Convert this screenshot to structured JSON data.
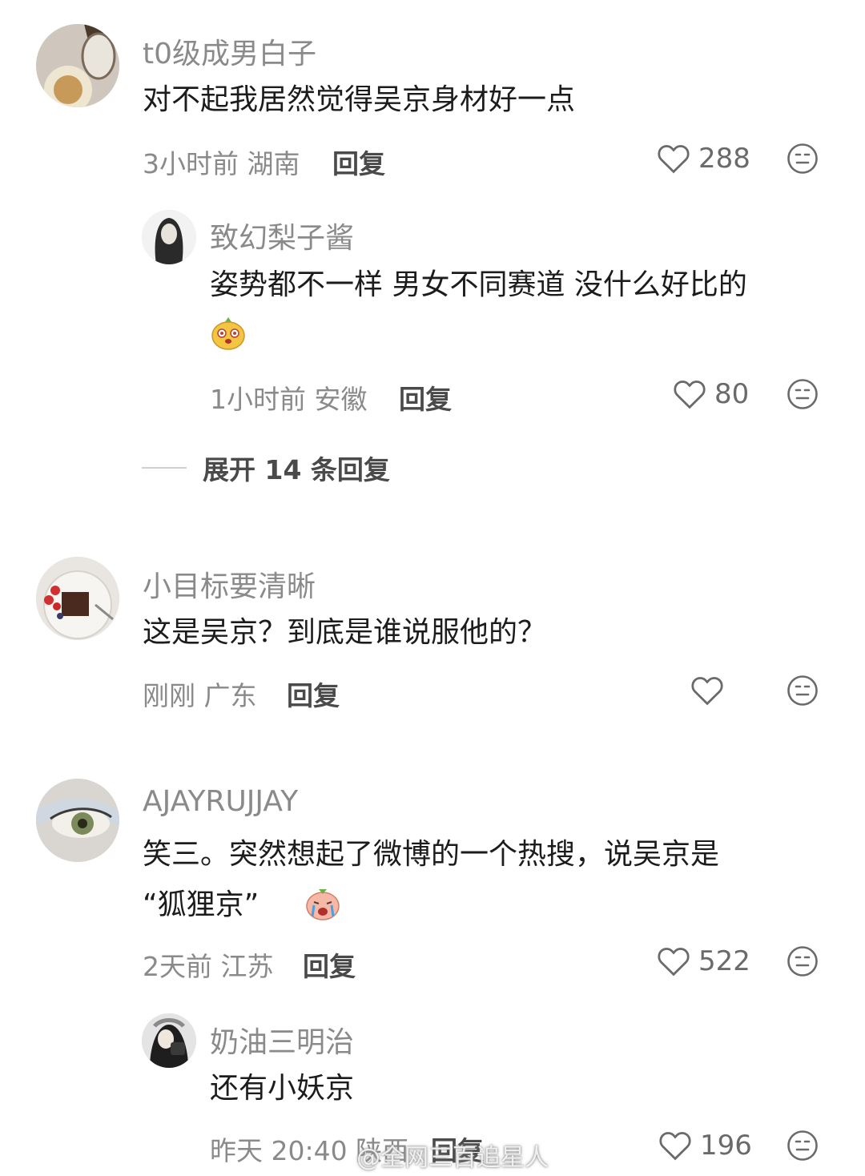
{
  "comments": [
    {
      "user": "t0级成男白子",
      "text": "对不起我居然觉得吴京身材好一点",
      "time_location": "3小时前 湖南",
      "reply_label": "回复",
      "likes": "288",
      "replies": [
        {
          "user": "致幻梨子酱",
          "text": "姿势都不一样 男女不同赛道 没什么好比的",
          "time_location": "1小时前 安徽",
          "reply_label": "回复",
          "likes": "80"
        }
      ],
      "expand_label": "展开 14 条回复"
    },
    {
      "user": "小目标要清晰",
      "text": "这是吴京？到底是谁说服他的？",
      "time_location": "刚刚 广东",
      "reply_label": "回复",
      "likes": ""
    },
    {
      "user": "AJAYRUJJAY",
      "text_line1": "笑三。突然想起了微博的一个热搜，说吴京是",
      "text_line2": "“狐狸京”",
      "time_location": "2天前 江苏",
      "reply_label": "回复",
      "likes": "522",
      "replies": [
        {
          "user": "奶油三明治",
          "text": "还有小妖京",
          "time_location": "昨天 20:40 陕西",
          "reply_label": "回复",
          "likes": "196"
        }
      ]
    }
  ],
  "watermark": "@全网三百追星人",
  "icons": {
    "like": "heart-outline-icon",
    "dislike": "neutral-face-icon"
  },
  "colors": {
    "username": "#8a8a8a",
    "meta": "#8a8a8a",
    "text": "#1c1c1c"
  }
}
